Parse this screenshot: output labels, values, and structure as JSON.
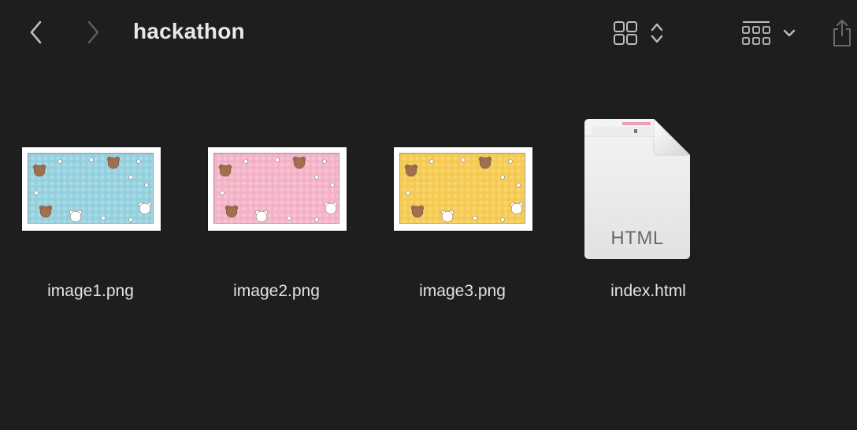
{
  "toolbar": {
    "title": "hackathon"
  },
  "icons": {
    "back": "chevron-left-icon",
    "forward": "chevron-right-icon",
    "view": "grid-view-icon",
    "view_toggle": "chevron-up-down-icon",
    "group": "group-by-icon",
    "group_toggle": "chevron-down-icon",
    "share": "share-icon"
  },
  "files": [
    {
      "name": "image1.png",
      "kind": "image",
      "color": "#a9dbe6",
      "grid": "#8ccad8"
    },
    {
      "name": "image2.png",
      "kind": "image",
      "color": "#f7c3d3",
      "grid": "#f2a9c1"
    },
    {
      "name": "image3.png",
      "kind": "image",
      "color": "#f9d66a",
      "grid": "#f2c54a"
    },
    {
      "name": "index.html",
      "kind": "document",
      "badge": "HTML"
    }
  ],
  "colors": {
    "background": "#1e1e1e",
    "text": "#e6e6e6",
    "icon": "#bdbdbd",
    "icon_dim": "#5a5a5a"
  }
}
